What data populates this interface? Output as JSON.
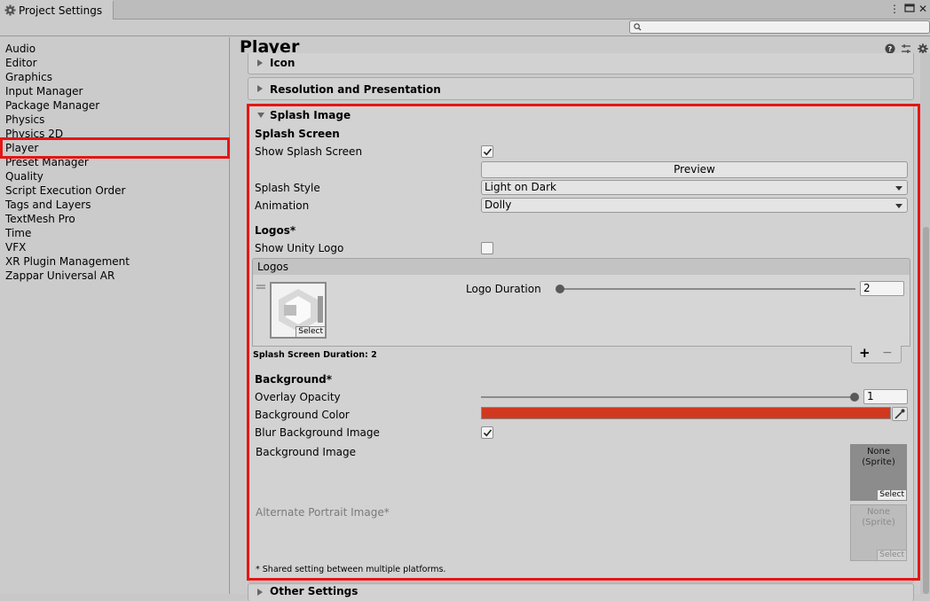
{
  "window": {
    "tab_title": "Project Settings",
    "search": {
      "placeholder": ""
    }
  },
  "sidebar": {
    "items": [
      {
        "label": "Audio"
      },
      {
        "label": "Editor"
      },
      {
        "label": "Graphics"
      },
      {
        "label": "Input Manager"
      },
      {
        "label": "Package Manager"
      },
      {
        "label": "Physics"
      },
      {
        "label": "Physics 2D"
      },
      {
        "label": "Player",
        "selected": true
      },
      {
        "label": "Preset Manager"
      },
      {
        "label": "Quality"
      },
      {
        "label": "Script Execution Order"
      },
      {
        "label": "Tags and Layers"
      },
      {
        "label": "TextMesh Pro"
      },
      {
        "label": "Time"
      },
      {
        "label": "VFX"
      },
      {
        "label": "XR Plugin Management"
      },
      {
        "label": "Zappar Universal AR"
      }
    ]
  },
  "main": {
    "title": "Player",
    "sections": {
      "icon": "Icon",
      "resolution": "Resolution and Presentation",
      "splash": "Splash Image",
      "other": "Other Settings"
    },
    "splash": {
      "splash_screen_heading": "Splash Screen",
      "show_splash_label": "Show Splash Screen",
      "show_splash_checked": true,
      "preview_label": "Preview",
      "splash_style_label": "Splash Style",
      "splash_style_value": "Light on Dark",
      "animation_label": "Animation",
      "animation_value": "Dolly",
      "logos_heading": "Logos*",
      "show_unity_logo_label": "Show Unity Logo",
      "show_unity_logo_checked": false,
      "logos_list_header": "Logos",
      "logo_select": "Select",
      "logo_duration_label": "Logo Duration",
      "logo_duration_value": "2",
      "splash_duration": "Splash Screen Duration: 2",
      "plus": "+",
      "minus": "−",
      "background_heading": "Background*",
      "overlay_opacity_label": "Overlay Opacity",
      "overlay_opacity_value": "1",
      "background_color_label": "Background Color",
      "background_color": "#d0391f",
      "blur_label": "Blur Background Image",
      "blur_checked": true,
      "bg_image_label": "Background Image",
      "bg_image_none": "None",
      "bg_image_type": "(Sprite)",
      "bg_image_select": "Select",
      "alt_portrait_label": "Alternate Portrait Image*",
      "alt_none": "None",
      "alt_type": "(Sprite)",
      "alt_select": "Select",
      "footnote": "* Shared setting between multiple platforms."
    }
  },
  "colors": {
    "highlight": "#e51515"
  }
}
